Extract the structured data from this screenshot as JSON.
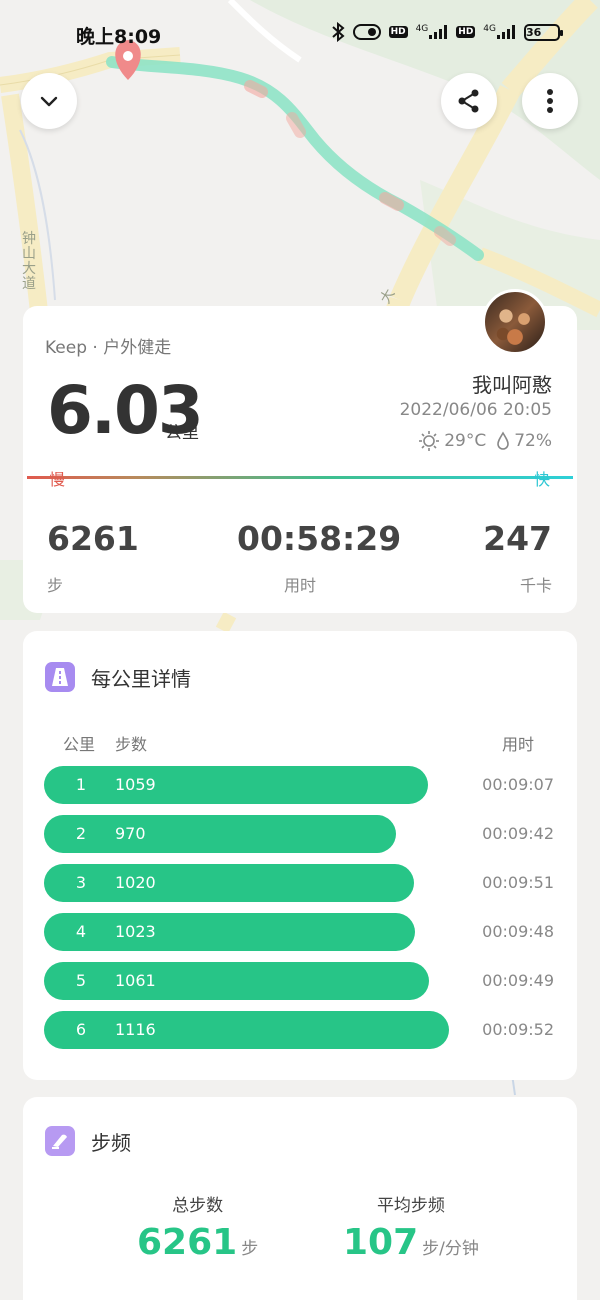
{
  "status_bar": {
    "time": "晚上8:09",
    "hd1": "HD",
    "net1": "4G",
    "hd2": "HD",
    "net2": "4G",
    "battery": "36"
  },
  "map": {
    "road_label_1": "钟山大道",
    "road_label_2": "大"
  },
  "summary": {
    "sport_type": "Keep · 户外健走",
    "distance": "6.03",
    "distance_unit": "公里",
    "user_name": "我叫阿憨",
    "datetime": "2022/06/06 20:05",
    "temperature": "29°C",
    "humidity": "72%",
    "pace_slow": "慢",
    "pace_fast": "快",
    "stats": {
      "steps": {
        "value": "6261",
        "label": "步"
      },
      "duration": {
        "value": "00:58:29",
        "label": "用时"
      },
      "calories": {
        "value": "247",
        "label": "千卡"
      }
    }
  },
  "splits": {
    "title": "每公里详情",
    "header": {
      "km": "公里",
      "steps": "步数",
      "time": "用时"
    },
    "rows": [
      {
        "km": "1",
        "steps": "1059",
        "time": "00:09:07",
        "bar": 0.949
      },
      {
        "km": "2",
        "steps": "970",
        "time": "00:09:42",
        "bar": 0.869
      },
      {
        "km": "3",
        "steps": "1020",
        "time": "00:09:51",
        "bar": 0.914
      },
      {
        "km": "4",
        "steps": "1023",
        "time": "00:09:48",
        "bar": 0.917
      },
      {
        "km": "5",
        "steps": "1061",
        "time": "00:09:49",
        "bar": 0.951
      },
      {
        "km": "6",
        "steps": "1116",
        "time": "00:09:52",
        "bar": 1.0
      }
    ]
  },
  "cadence": {
    "title": "步频",
    "total_label": "总步数",
    "total_value": "6261",
    "total_unit": "步",
    "avg_label": "平均步频",
    "avg_value": "107",
    "avg_unit": "步/分钟"
  },
  "colors": {
    "accent": "#27c587",
    "pace_slow": "#e05a4e",
    "pace_fast": "#2ec7d4",
    "route": "#8fe3c6",
    "start_pin": "#f08a8a"
  },
  "icons": {
    "collapse": "chevron-down-icon",
    "share": "share-icon",
    "more": "more-vertical-icon",
    "splits": "road-icon",
    "cadence": "shoe-icon"
  }
}
